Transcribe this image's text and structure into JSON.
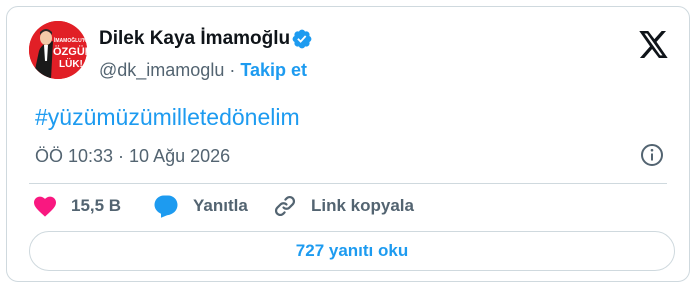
{
  "author": {
    "name": "Dilek Kaya İmamoğlu",
    "handle": "@dk_imamoglu",
    "separator": "·",
    "follow_label": "Takip et",
    "avatar_text_top": "İMAMOĞLU'NA",
    "avatar_text_main": "ÖZGÜR",
    "avatar_text_bottom": "LÜK!"
  },
  "tweet": {
    "text": "#yüzümüzümilletedönelim",
    "timestamp": "ÖÖ 10:33 · 10 Ağu 2026"
  },
  "actions": {
    "like_count": "15,5 B",
    "reply_label": "Yanıtla",
    "copy_link_label": "Link kopyala"
  },
  "replies_button_label": "727 yanıtı oku",
  "colors": {
    "accent": "#1d9bf0",
    "like": "#f91880",
    "muted_text": "#536471",
    "avatar_bg": "#e11f26"
  },
  "icons": [
    "verified-badge-icon",
    "x-logo-icon",
    "info-icon",
    "heart-icon",
    "reply-bubble-icon",
    "link-icon"
  ]
}
